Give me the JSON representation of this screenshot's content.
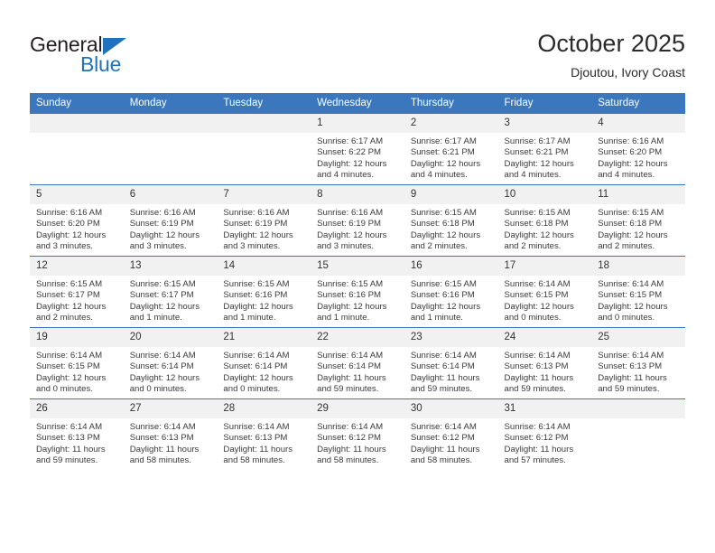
{
  "branding": {
    "logo_primary": "General",
    "logo_secondary": "Blue",
    "logo_icon": "triangle-icon"
  },
  "header": {
    "title": "October 2025",
    "subtitle": "Djoutou, Ivory Coast"
  },
  "theme": {
    "header_bg": "#3b77bc",
    "daynum_bg": "#f1f1f1",
    "accent": "#1f72bb",
    "text": "#2b2b2b"
  },
  "calendar": {
    "weekday_headers": [
      "Sunday",
      "Monday",
      "Tuesday",
      "Wednesday",
      "Thursday",
      "Friday",
      "Saturday"
    ],
    "weeks": [
      [
        {
          "day": "",
          "empty": true
        },
        {
          "day": "",
          "empty": true
        },
        {
          "day": "",
          "empty": true
        },
        {
          "day": "1",
          "sunrise": "Sunrise: 6:17 AM",
          "sunset": "Sunset: 6:22 PM",
          "daylight": "Daylight: 12 hours and 4 minutes."
        },
        {
          "day": "2",
          "sunrise": "Sunrise: 6:17 AM",
          "sunset": "Sunset: 6:21 PM",
          "daylight": "Daylight: 12 hours and 4 minutes."
        },
        {
          "day": "3",
          "sunrise": "Sunrise: 6:17 AM",
          "sunset": "Sunset: 6:21 PM",
          "daylight": "Daylight: 12 hours and 4 minutes."
        },
        {
          "day": "4",
          "sunrise": "Sunrise: 6:16 AM",
          "sunset": "Sunset: 6:20 PM",
          "daylight": "Daylight: 12 hours and 4 minutes."
        }
      ],
      [
        {
          "day": "5",
          "sunrise": "Sunrise: 6:16 AM",
          "sunset": "Sunset: 6:20 PM",
          "daylight": "Daylight: 12 hours and 3 minutes."
        },
        {
          "day": "6",
          "sunrise": "Sunrise: 6:16 AM",
          "sunset": "Sunset: 6:19 PM",
          "daylight": "Daylight: 12 hours and 3 minutes."
        },
        {
          "day": "7",
          "sunrise": "Sunrise: 6:16 AM",
          "sunset": "Sunset: 6:19 PM",
          "daylight": "Daylight: 12 hours and 3 minutes."
        },
        {
          "day": "8",
          "sunrise": "Sunrise: 6:16 AM",
          "sunset": "Sunset: 6:19 PM",
          "daylight": "Daylight: 12 hours and 3 minutes."
        },
        {
          "day": "9",
          "sunrise": "Sunrise: 6:15 AM",
          "sunset": "Sunset: 6:18 PM",
          "daylight": "Daylight: 12 hours and 2 minutes."
        },
        {
          "day": "10",
          "sunrise": "Sunrise: 6:15 AM",
          "sunset": "Sunset: 6:18 PM",
          "daylight": "Daylight: 12 hours and 2 minutes."
        },
        {
          "day": "11",
          "sunrise": "Sunrise: 6:15 AM",
          "sunset": "Sunset: 6:18 PM",
          "daylight": "Daylight: 12 hours and 2 minutes."
        }
      ],
      [
        {
          "day": "12",
          "sunrise": "Sunrise: 6:15 AM",
          "sunset": "Sunset: 6:17 PM",
          "daylight": "Daylight: 12 hours and 2 minutes."
        },
        {
          "day": "13",
          "sunrise": "Sunrise: 6:15 AM",
          "sunset": "Sunset: 6:17 PM",
          "daylight": "Daylight: 12 hours and 1 minute."
        },
        {
          "day": "14",
          "sunrise": "Sunrise: 6:15 AM",
          "sunset": "Sunset: 6:16 PM",
          "daylight": "Daylight: 12 hours and 1 minute."
        },
        {
          "day": "15",
          "sunrise": "Sunrise: 6:15 AM",
          "sunset": "Sunset: 6:16 PM",
          "daylight": "Daylight: 12 hours and 1 minute."
        },
        {
          "day": "16",
          "sunrise": "Sunrise: 6:15 AM",
          "sunset": "Sunset: 6:16 PM",
          "daylight": "Daylight: 12 hours and 1 minute."
        },
        {
          "day": "17",
          "sunrise": "Sunrise: 6:14 AM",
          "sunset": "Sunset: 6:15 PM",
          "daylight": "Daylight: 12 hours and 0 minutes."
        },
        {
          "day": "18",
          "sunrise": "Sunrise: 6:14 AM",
          "sunset": "Sunset: 6:15 PM",
          "daylight": "Daylight: 12 hours and 0 minutes."
        }
      ],
      [
        {
          "day": "19",
          "sunrise": "Sunrise: 6:14 AM",
          "sunset": "Sunset: 6:15 PM",
          "daylight": "Daylight: 12 hours and 0 minutes."
        },
        {
          "day": "20",
          "sunrise": "Sunrise: 6:14 AM",
          "sunset": "Sunset: 6:14 PM",
          "daylight": "Daylight: 12 hours and 0 minutes."
        },
        {
          "day": "21",
          "sunrise": "Sunrise: 6:14 AM",
          "sunset": "Sunset: 6:14 PM",
          "daylight": "Daylight: 12 hours and 0 minutes."
        },
        {
          "day": "22",
          "sunrise": "Sunrise: 6:14 AM",
          "sunset": "Sunset: 6:14 PM",
          "daylight": "Daylight: 11 hours and 59 minutes."
        },
        {
          "day": "23",
          "sunrise": "Sunrise: 6:14 AM",
          "sunset": "Sunset: 6:14 PM",
          "daylight": "Daylight: 11 hours and 59 minutes."
        },
        {
          "day": "24",
          "sunrise": "Sunrise: 6:14 AM",
          "sunset": "Sunset: 6:13 PM",
          "daylight": "Daylight: 11 hours and 59 minutes."
        },
        {
          "day": "25",
          "sunrise": "Sunrise: 6:14 AM",
          "sunset": "Sunset: 6:13 PM",
          "daylight": "Daylight: 11 hours and 59 minutes."
        }
      ],
      [
        {
          "day": "26",
          "sunrise": "Sunrise: 6:14 AM",
          "sunset": "Sunset: 6:13 PM",
          "daylight": "Daylight: 11 hours and 59 minutes."
        },
        {
          "day": "27",
          "sunrise": "Sunrise: 6:14 AM",
          "sunset": "Sunset: 6:13 PM",
          "daylight": "Daylight: 11 hours and 58 minutes."
        },
        {
          "day": "28",
          "sunrise": "Sunrise: 6:14 AM",
          "sunset": "Sunset: 6:13 PM",
          "daylight": "Daylight: 11 hours and 58 minutes."
        },
        {
          "day": "29",
          "sunrise": "Sunrise: 6:14 AM",
          "sunset": "Sunset: 6:12 PM",
          "daylight": "Daylight: 11 hours and 58 minutes."
        },
        {
          "day": "30",
          "sunrise": "Sunrise: 6:14 AM",
          "sunset": "Sunset: 6:12 PM",
          "daylight": "Daylight: 11 hours and 58 minutes."
        },
        {
          "day": "31",
          "sunrise": "Sunrise: 6:14 AM",
          "sunset": "Sunset: 6:12 PM",
          "daylight": "Daylight: 11 hours and 57 minutes."
        },
        {
          "day": "",
          "empty": true
        }
      ]
    ]
  }
}
